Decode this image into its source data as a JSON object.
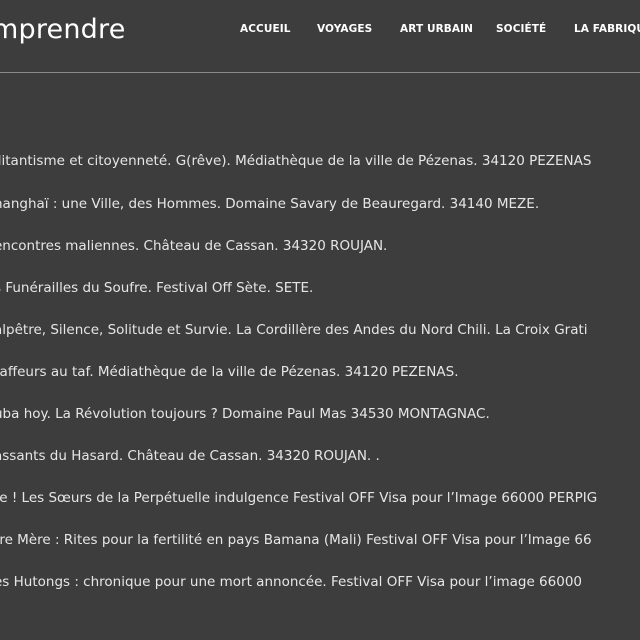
{
  "header": {
    "site_title": "mprendre",
    "nav": [
      {
        "label": "ACCUEIL"
      },
      {
        "label": "VOYAGES"
      },
      {
        "label": "ART URBAIN"
      },
      {
        "label": "SOCIÉTÉ"
      },
      {
        "label": "LA FABRIQUE"
      }
    ]
  },
  "entries": [
    "ilitantisme et citoyenneté. G(rêve). Médiathèque de la ville de Pézenas. 34120 PEZENAS",
    "hanghaï : une Ville, des Hommes. Domaine Savary de Beauregard. 34140 MEZE.",
    "encontres maliennes. Château de Cassan. 34320 ROUJAN.",
    "s Funérailles du Soufre. Festival Off Sète. SETE.",
    "alpêtre, Silence, Solitude et Survie. La Cordillère des Andes du Nord Chili. La Croix Grati",
    "raffeurs au taf. Médiathèque de la ville de Pézenas. 34120 PEZENAS.",
    "uba hoy. La Révolution toujours ? Domaine Paul Mas 34530 MONTAGNAC.",
    "assants du Hasard. Château de Cassan. 34320 ROUJAN. .",
    "re ! Les Sœurs de la Perpétuelle indulgence Festival OFF Visa pour l’Image 66000 PERPIG",
    "rre Mère : Rites pour la fertilité en pays Bamana (Mali) Festival OFF Visa pour l’Image 66",
    "es Hutongs : chronique pour une mort annoncée. Festival OFF Visa pour l’image 66000"
  ]
}
